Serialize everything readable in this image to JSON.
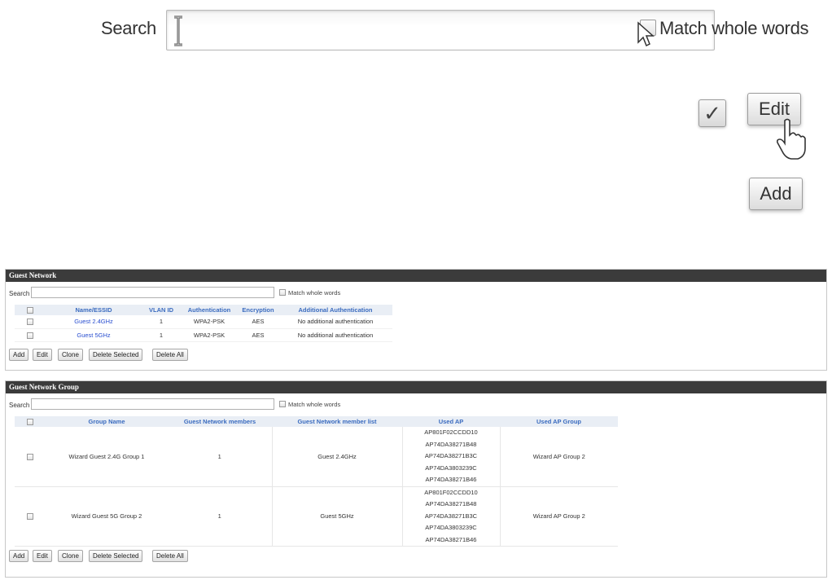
{
  "zoom": {
    "search_label": "Search",
    "match_label": "Match whole words",
    "edit_label": "Edit",
    "add_label": "Add",
    "checked_glyph": "✓"
  },
  "guest_network": {
    "title": "Guest Network",
    "search_label": "Search",
    "search_value": "",
    "match_label": "Match whole words",
    "columns": [
      "Name/ESSID",
      "VLAN ID",
      "Authentication",
      "Encryption",
      "Additional Authentication"
    ],
    "rows": [
      {
        "name": "Guest 2.4GHz",
        "vlan": "1",
        "auth": "WPA2-PSK",
        "enc": "AES",
        "add_auth": "No additional authentication"
      },
      {
        "name": "Guest 5GHz",
        "vlan": "1",
        "auth": "WPA2-PSK",
        "enc": "AES",
        "add_auth": "No additional authentication"
      }
    ],
    "buttons": {
      "add": "Add",
      "edit": "Edit",
      "clone": "Clone",
      "delete_selected": "Delete Selected",
      "delete_all": "Delete All"
    }
  },
  "guest_network_group": {
    "title": "Guest Network Group",
    "search_label": "Search",
    "search_value": "",
    "match_label": "Match whole words",
    "columns": [
      "Group Name",
      "Guest Network members",
      "Guest Network member list",
      "Used AP",
      "Used AP Group"
    ],
    "rows": [
      {
        "group_name": "Wizard Guest 2.4G Group 1",
        "members": "1",
        "member_list": "Guest 2.4GHz",
        "used_ap": [
          "AP801F02CCDD10",
          "AP74DA38271B48",
          "AP74DA38271B3C",
          "AP74DA3803239C",
          "AP74DA38271B46"
        ],
        "used_ap_group": "Wizard AP Group 2"
      },
      {
        "group_name": "Wizard Guest 5G Group 2",
        "members": "1",
        "member_list": "Guest 5GHz",
        "used_ap": [
          "AP801F02CCDD10",
          "AP74DA38271B48",
          "AP74DA38271B3C",
          "AP74DA3803239C",
          "AP74DA38271B46"
        ],
        "used_ap_group": "Wizard AP Group 2"
      }
    ],
    "buttons": {
      "add": "Add",
      "edit": "Edit",
      "clone": "Clone",
      "delete_selected": "Delete Selected",
      "delete_all": "Delete All"
    }
  },
  "colors": {
    "header_bg": "#3b3b3b",
    "column_header_text": "#3a6bbf",
    "link": "#2a4fd0"
  }
}
